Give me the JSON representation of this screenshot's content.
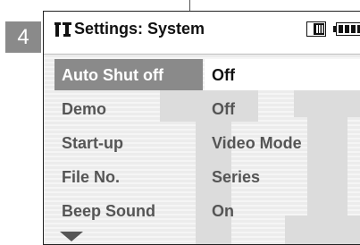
{
  "step_number": "4",
  "header": {
    "title": "Settings: System",
    "settings_icon": "settings-icon",
    "mode_icon": "mode-icon",
    "battery_icon": "battery-icon"
  },
  "menu": {
    "items": [
      {
        "label": "Auto Shut off",
        "value": "Off",
        "selected": true
      },
      {
        "label": "Demo",
        "value": "Off",
        "selected": false
      },
      {
        "label": "Start-up",
        "value": "Video Mode",
        "selected": false
      },
      {
        "label": "File No.",
        "value": "Series",
        "selected": false
      },
      {
        "label": "Beep Sound",
        "value": "On",
        "selected": false
      }
    ],
    "more_indicator": "chevron-down-icon"
  },
  "colors": {
    "highlight": "#8a8a8a",
    "text": "#555555",
    "title_text": "#111111"
  }
}
